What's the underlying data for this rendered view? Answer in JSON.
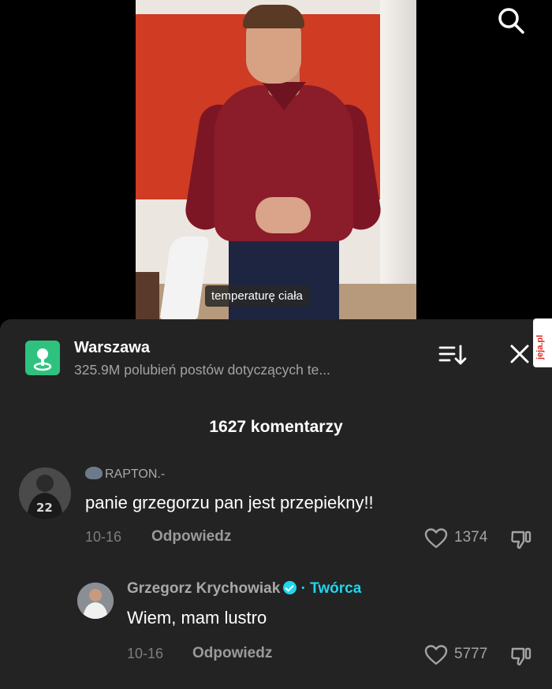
{
  "video": {
    "caption": "temperaturę ciała"
  },
  "sheet": {
    "location_title": "Warszawa",
    "location_subtitle": "325.9M polubień postów dotyczących te...",
    "comments_count": "1627 komentarzy"
  },
  "watermark": {
    "text": "jeja.pl"
  },
  "comments": [
    {
      "username": "RAPTON.-",
      "text": "panie grzegorzu pan jest przepiekny!!",
      "date": "10-16",
      "reply_label": "Odpowiedz",
      "likes": "1374"
    },
    {
      "username": "Grzegorz Krychowiak",
      "creator_label": "· Twórca",
      "text": "Wiem, mam lustro",
      "date": "10-16",
      "reply_label": "Odpowiedz",
      "likes": "5777"
    }
  ],
  "icons": [
    "search-icon",
    "location-pin-icon",
    "sort-icon",
    "close-icon",
    "heart-icon",
    "dislike-icon",
    "verified-icon"
  ],
  "colors": {
    "sheet_bg": "#232323",
    "accent_cyan": "#20d5ec",
    "location_green": "#2ec27e"
  }
}
